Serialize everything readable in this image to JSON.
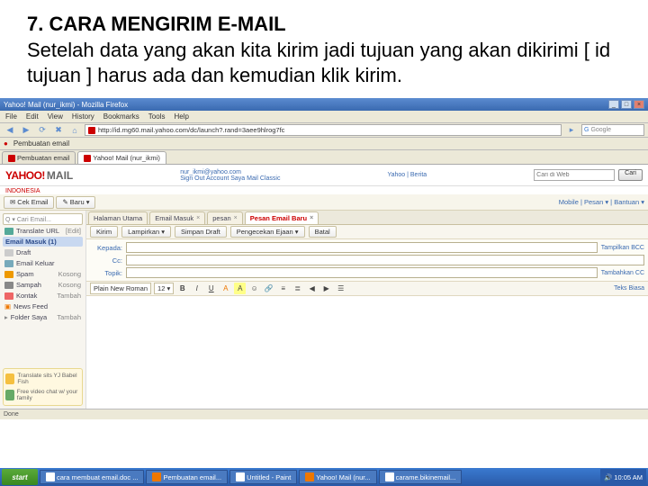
{
  "slide": {
    "title": "7. CARA MENGIRIM E-MAIL",
    "body": "Setelah data yang akan kita kirim jadi tujuan yang akan dikirimi [ id tujuan ] harus ada dan kemudian klik kirim."
  },
  "browser": {
    "window_title": "Yahoo! Mail (nur_ikmi) - Mozilla Firefox",
    "menu": {
      "file": "File",
      "edit": "Edit",
      "view": "View",
      "history": "History",
      "bookmarks": "Bookmarks",
      "tools": "Tools",
      "help": "Help"
    },
    "url": "http://id.mg60.mail.yahoo.com/dc/launch?.rand=3aee9hlrog7fc",
    "search_placeholder": "Google",
    "bookmark1": "Pembuatan email",
    "tabs": {
      "tab1": "Pembuatan email",
      "tab2": "Yahoo! Mail (nur_ikmi)"
    },
    "statusbar": "Done"
  },
  "yahoo": {
    "logo_main": "YAHOO!",
    "logo_mail": "MAIL",
    "logo_sub": "INDONESIA",
    "meta1": "nur_ikmi@yahoo.com",
    "meta2": "Sign Out  Account Saya  Mail Classic",
    "meta3": "Yahoo | Berita",
    "search_placeholder": "Cari di Web",
    "search_btn": "Cari",
    "toolbar": {
      "cek": "Cek Email",
      "baru": "Baru ▾",
      "mobile": "Mobile | Pesan ▾ | Bantuan ▾"
    },
    "sidebar": {
      "search_ph": "Q ▾ Cari Email...",
      "translate": "Translate URL",
      "edit": "[Edit]",
      "inbox_head": "Email Masuk (1)",
      "draft": "Draft",
      "sent": "Email Keluar",
      "spam": "Spam",
      "trash": "Sampah",
      "kosong1": "Kosong",
      "kosong2": "Kosong",
      "kontak": "Kontak",
      "tambah": "Tambah",
      "news": "News Feed",
      "folders": "Folder Saya",
      "tambah2": "Tambah",
      "promo1": "Translate sits YJ Babel Fish",
      "promo2": "Free video chat w/ your family"
    },
    "mailtabs": {
      "home": "Halaman Utama",
      "inbox": "Email Masuk",
      "msg": "pesan",
      "compose": "Pesan Email Baru"
    },
    "compose_bar": {
      "kirim": "Kirim",
      "lampiran": "Lampirkan ▾",
      "simpan": "Simpan Draft",
      "eja": "Pengecekan Ejaan ▾",
      "batal": "Batal"
    },
    "fields": {
      "kepada": "Kepada:",
      "cc": "Cc:",
      "topic": "Topik:",
      "show_bcc": "Tampilkan BCC",
      "cc_link": "Tambahkan CC"
    },
    "rich": {
      "font": "Plain New Roman",
      "size": "12 ▾",
      "mode": "Teks Biasa"
    }
  },
  "taskbar": {
    "start": "start",
    "t1": "cara membuat email.doc ...",
    "t2": "Pembuatan email...",
    "t3": "Untitled - Paint",
    "t4": "Yahoo! Mail (nur...",
    "t5": "carame.bikinemail...",
    "time": "10:05 AM"
  }
}
